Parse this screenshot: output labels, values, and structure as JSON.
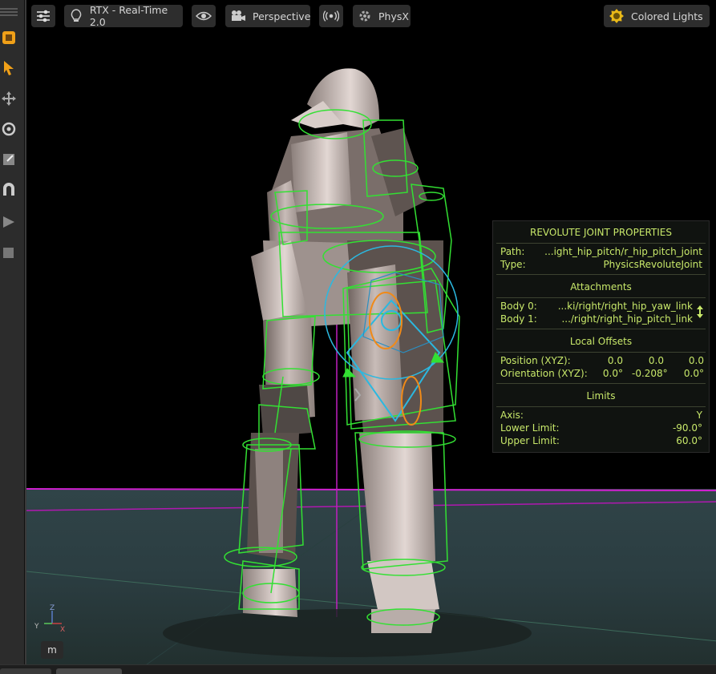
{
  "toolbar_left": {
    "tools": [
      {
        "name": "create-icon"
      },
      {
        "name": "select-icon"
      },
      {
        "name": "move-icon"
      },
      {
        "name": "rotate-icon"
      },
      {
        "name": "scale-icon"
      },
      {
        "name": "snap-icon"
      },
      {
        "name": "play-icon"
      },
      {
        "name": "stop-icon"
      }
    ]
  },
  "viewport_bar": {
    "settings_icon": "sliders-icon",
    "renderer": "RTX - Real-Time 2.0",
    "visibility_icon": "eye-icon",
    "camera": "Perspective",
    "audio_icon": "broadcast-icon",
    "physics": "PhysX",
    "lights": "Colored Lights"
  },
  "panel": {
    "title": "REVOLUTE JOINT PROPERTIES",
    "path_label": "Path:",
    "path_value": "...ight_hip_pitch/r_hip_pitch_joint",
    "type_label": "Type:",
    "type_value": "PhysicsRevoluteJoint",
    "attachments_title": "Attachments",
    "body0_label": "Body 0:",
    "body0_value": "...ki/right/right_hip_yaw_link",
    "body1_label": "Body 1:",
    "body1_value": ".../right/right_hip_pitch_link",
    "offsets_title": "Local Offsets",
    "position_label": "Position (XYZ):",
    "position_values": [
      "0.0",
      "0.0",
      "0.0"
    ],
    "orientation_label": "Orientation (XYZ):",
    "orientation_values": [
      "0.0°",
      "-0.208°",
      "0.0°"
    ],
    "limits_title": "Limits",
    "axis_label": "Axis:",
    "axis_value": "Y",
    "lower_label": "Lower Limit:",
    "lower_value": "-90.0°",
    "upper_label": "Upper Limit:",
    "upper_value": "60.0°"
  },
  "gizmo": {
    "z": "Z",
    "y": "Y",
    "x": "X"
  },
  "m_button": "m",
  "colors": {
    "panel_text": "#c8e86a",
    "collider": "#33e033",
    "joint": "#2bb8e0",
    "ground_line": "#d020d0"
  }
}
